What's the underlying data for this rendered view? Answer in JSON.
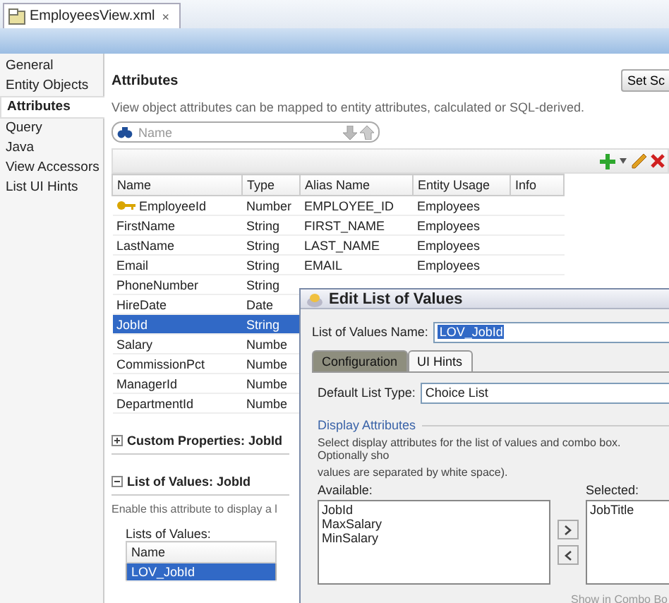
{
  "editor_tabs": [
    {
      "label": "EmployeesView.xml",
      "close": "×",
      "selected": true
    }
  ],
  "nav": {
    "items": [
      {
        "label": "General",
        "selected": false
      },
      {
        "label": "Entity Objects",
        "selected": false
      },
      {
        "label": "Attributes",
        "selected": true
      },
      {
        "label": "Query",
        "selected": false
      },
      {
        "label": "Java",
        "selected": false
      },
      {
        "label": "View Accessors",
        "selected": false
      },
      {
        "label": "List UI Hints",
        "selected": false
      }
    ]
  },
  "attributes": {
    "title": "Attributes",
    "set_button": "Set Sc",
    "description": "View object attributes can be mapped to entity attributes, calculated or SQL-derived.",
    "search": {
      "placeholder": "Name"
    },
    "table": {
      "columns": [
        "Name",
        "Type",
        "Alias Name",
        "Entity Usage",
        "Info"
      ],
      "rows": [
        {
          "name": "EmployeeId",
          "type": "Number",
          "alias": "EMPLOYEE_ID",
          "entity": "Employees",
          "key": true,
          "selected": false
        },
        {
          "name": "FirstName",
          "type": "String",
          "alias": "FIRST_NAME",
          "entity": "Employees",
          "key": false,
          "selected": false
        },
        {
          "name": "LastName",
          "type": "String",
          "alias": "LAST_NAME",
          "entity": "Employees",
          "key": false,
          "selected": false
        },
        {
          "name": "Email",
          "type": "String",
          "alias": "EMAIL",
          "entity": "Employees",
          "key": false,
          "selected": false
        },
        {
          "name": "PhoneNumber",
          "type": "String",
          "key": false,
          "selected": false
        },
        {
          "name": "HireDate",
          "type": "Date",
          "key": false,
          "selected": false
        },
        {
          "name": "JobId",
          "type": "String",
          "key": false,
          "selected": true
        },
        {
          "name": "Salary",
          "type": "Numbe",
          "key": false,
          "selected": false
        },
        {
          "name": "CommissionPct",
          "type": "Numbe",
          "key": false,
          "selected": false
        },
        {
          "name": "ManagerId",
          "type": "Numbe",
          "key": false,
          "selected": false
        },
        {
          "name": "DepartmentId",
          "type": "Numbe",
          "key": false,
          "selected": false
        }
      ]
    }
  },
  "custom_properties": {
    "title": "Custom Properties: JobId",
    "expanded": false
  },
  "list_of_values": {
    "title": "List of Values: JobId",
    "expanded": true,
    "description": "Enable this attribute to display a l",
    "list_label": "Lists of Values:",
    "list_column": "Name",
    "items": [
      {
        "label": "LOV_JobId",
        "selected": true
      }
    ]
  },
  "dialog": {
    "title": "Edit List of Values",
    "name_label": "List of Values Name:",
    "name_value": "LOV_JobId",
    "name_value_selected": true,
    "tabs": [
      {
        "label": "Configuration",
        "selected": false
      },
      {
        "label": "UI Hints",
        "selected": true
      }
    ],
    "list_type_label": "Default List Type:",
    "list_type_value": "Choice List",
    "section_title": "Display Attributes",
    "help_lines": [
      "Select display attributes for the list of values and combo box. Optionally sho",
      "values are separated by white space)."
    ],
    "available_label": "Available:",
    "available": [
      "JobId",
      "MaxSalary",
      "MinSalary"
    ],
    "selected_label": "Selected:",
    "selected": [
      "JobTitle"
    ],
    "combo_label": "Show in Combo Bo",
    "combo_disabled": true
  }
}
